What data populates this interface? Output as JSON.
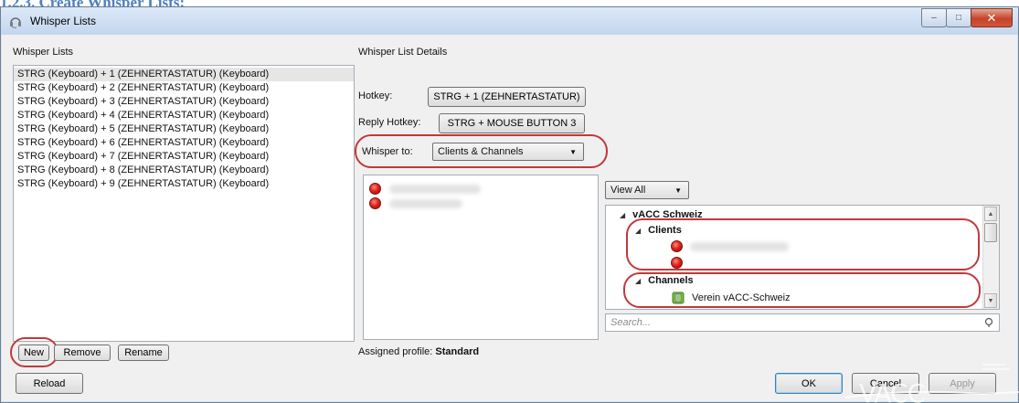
{
  "document_heading": "1.2.3.   Create Whisper Lists:",
  "window": {
    "title": "Whisper Lists",
    "controls": {
      "minimize": "–",
      "maximize": "□",
      "close": "✕"
    }
  },
  "left": {
    "section_label": "Whisper Lists",
    "items": [
      "STRG (Keyboard) + 1 (ZEHNERTASTATUR) (Keyboard)",
      "STRG (Keyboard) + 2 (ZEHNERTASTATUR) (Keyboard)",
      "STRG (Keyboard) + 3 (ZEHNERTASTATUR) (Keyboard)",
      "STRG (Keyboard) + 4 (ZEHNERTASTATUR) (Keyboard)",
      "STRG (Keyboard) + 5 (ZEHNERTASTATUR) (Keyboard)",
      "STRG (Keyboard) + 6 (ZEHNERTASTATUR) (Keyboard)",
      "STRG (Keyboard) + 7 (ZEHNERTASTATUR) (Keyboard)",
      "STRG (Keyboard) + 8 (ZEHNERTASTATUR) (Keyboard)",
      "STRG (Keyboard) + 9 (ZEHNERTASTATUR) (Keyboard)"
    ],
    "buttons": {
      "new": "New",
      "remove": "Remove",
      "rename": "Rename"
    }
  },
  "details": {
    "section_label": "Whisper List Details",
    "hotkey_label": "Hotkey:",
    "hotkey_value": "STRG + 1 (ZEHNERTASTATUR)",
    "reply_hotkey_label": "Reply Hotkey:",
    "reply_hotkey_value": "STRG + MOUSE BUTTON 3",
    "whisper_to_label": "Whisper to:",
    "whisper_to_value": "Clients & Channels",
    "assigned_profile_label": "Assigned profile:",
    "assigned_profile_value": "Standard"
  },
  "tree": {
    "view_filter": "View All",
    "root": "vACC Schweiz",
    "clients_label": "Clients",
    "channels_label": "Channels",
    "channel_item": "Verein vACC-Schweiz",
    "search_placeholder": "Search..."
  },
  "footer": {
    "reload": "Reload",
    "ok": "OK",
    "cancel": "Cancel",
    "apply": "Apply"
  },
  "colors": {
    "heading": "#4f81bd",
    "annotation_oval": "#c0393b",
    "status_red": "#e2231a"
  }
}
